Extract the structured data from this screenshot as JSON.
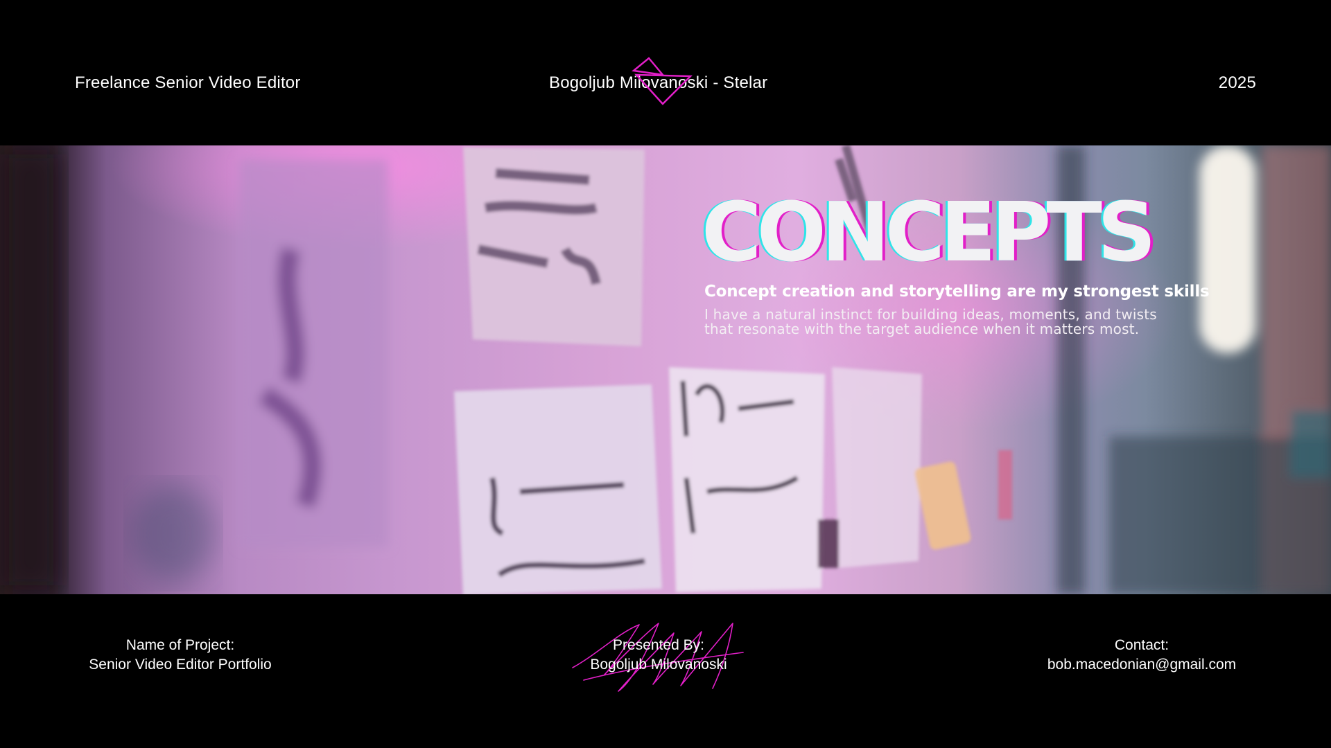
{
  "header": {
    "role": "Freelance Senior Video Editor",
    "name": "Bogoljub Milovanoski - Stelar",
    "year": "2025"
  },
  "hero": {
    "title": "CONCEPTS",
    "subtitle": "Concept creation and storytelling are my strongest skills",
    "body_line1": "I have a natural instinct for building ideas, moments, and twists",
    "body_line2": "that resonate with the target audience when it matters most."
  },
  "footer": {
    "project_label": "Name of Project:",
    "project_value": "Senior Video Editor Portfolio",
    "presented_label": "Presented By:",
    "presented_value": "Bogoljub Milovanoski",
    "contact_label": "Contact:",
    "contact_value": "bob.macedonian@gmail.com"
  },
  "colors": {
    "background": "#000000",
    "accent_magenta": "#e21fc8",
    "accent_cyan": "#2fe4e8",
    "text": "#ffffff"
  },
  "icons": {
    "logo": "triangle-logo-icon",
    "signature": "signature-scribble-icon"
  }
}
